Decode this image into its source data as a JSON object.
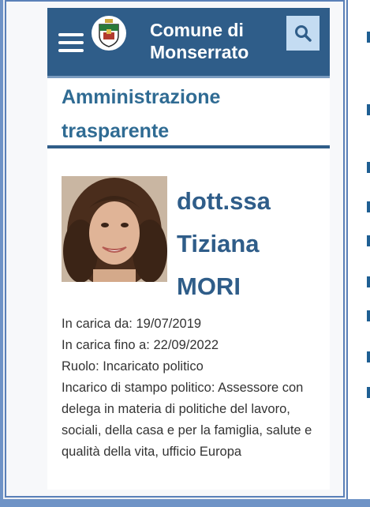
{
  "colors": {
    "header_bg": "#2f5d89",
    "title_color": "#2f6b93",
    "search_bg": "#c4dcf2"
  },
  "header": {
    "brand_line1": "Comune di",
    "brand_line2": "Monserrato",
    "menu_icon": "hamburger-menu-icon",
    "search_icon": "search-icon",
    "logo": "municipal-coat-of-arms"
  },
  "section": {
    "title_line1": "Amministrazione",
    "title_line2": "trasparente"
  },
  "profile": {
    "title_prefix": "dott.ssa",
    "first_name": "Tiziana",
    "last_name": "MORI",
    "in_carica_da": "In carica da: 19/07/2019",
    "in_carica_fino": "In carica fino a: 22/09/2022",
    "ruolo": "Ruolo: Incaricato politico",
    "incarico": "Incarico di stampo politico: Assessore con delega in materia di politiche del lavoro, sociali, della casa e per la famiglia, salute e qualità della vita, ufficio Europa"
  }
}
